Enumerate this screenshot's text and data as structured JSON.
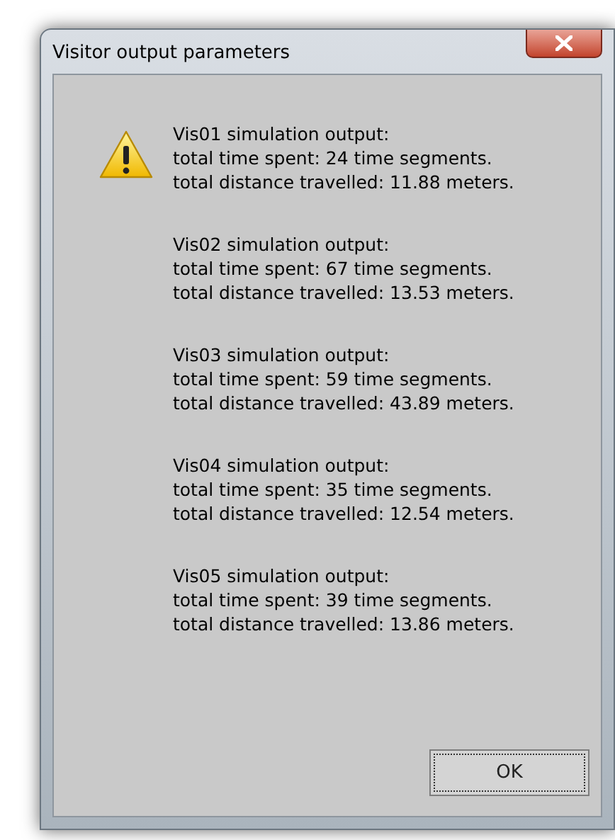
{
  "window": {
    "title": "Visitor output parameters"
  },
  "messages": [
    {
      "lines": [
        "Vis01 simulation output:",
        "total time spent: 24 time segments.",
        "total distance travelled: 11.88 meters."
      ]
    },
    {
      "lines": [
        "Vis02 simulation output:",
        "total time spent: 67 time segments.",
        "total distance travelled: 13.53 meters."
      ]
    },
    {
      "lines": [
        "Vis03 simulation output:",
        "total time spent: 59 time segments.",
        "total distance travelled: 43.89 meters."
      ]
    },
    {
      "lines": [
        "Vis04 simulation output:",
        "total time spent: 35 time segments.",
        "total distance travelled: 12.54 meters."
      ]
    },
    {
      "lines": [
        "Vis05 simulation output:",
        "total time spent: 39 time segments.",
        "total distance travelled: 13.86 meters."
      ]
    }
  ],
  "buttons": [
    "OK"
  ]
}
